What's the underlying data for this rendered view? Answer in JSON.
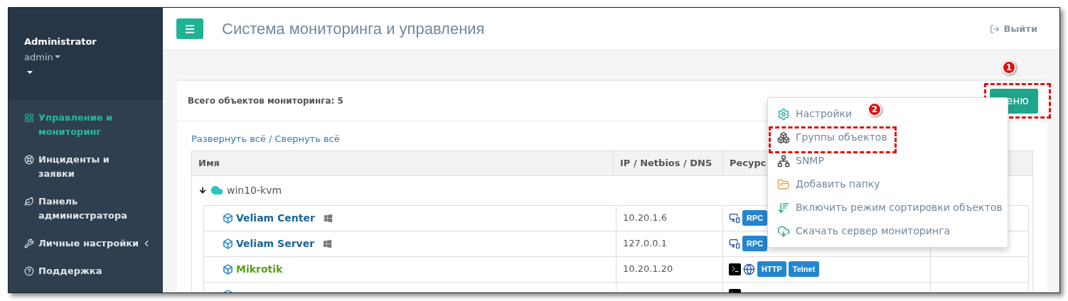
{
  "sidebar": {
    "user_name": "Administrator",
    "user_login": "admin",
    "items": [
      {
        "label": "Управление и мониторинг",
        "selected": true,
        "submenu": false
      },
      {
        "label": "Инциденты и заявки",
        "selected": false,
        "submenu": false
      },
      {
        "label": "Панель администратора",
        "selected": false,
        "submenu": false
      },
      {
        "label": "Личные настройки",
        "selected": false,
        "submenu": true
      },
      {
        "label": "Поддержка",
        "selected": false,
        "submenu": false
      }
    ]
  },
  "header": {
    "title": "Система мониторинга и управления",
    "logout": "Выйти"
  },
  "panel": {
    "summary": "Всего объектов мониторинга: 5",
    "menu_button": "еню",
    "menu_annotation": "1",
    "expand_all": "Развернуть всё",
    "separator": "/",
    "collapse_all": "Свернуть всё"
  },
  "table": {
    "columns": [
      "Имя",
      "IP / Netbios / DNS",
      "Ресурс"
    ],
    "groups": [
      {
        "name": "win10-kvm",
        "expanded": true,
        "children": [
          {
            "kind": "host",
            "name": "Veliam Center",
            "color": "#1a6496",
            "windows": true,
            "ip": "10.20.1.6",
            "resources": [
              {
                "kind": "rdp"
              },
              {
                "kind": "badge",
                "label": "RPC"
              }
            ]
          },
          {
            "kind": "host",
            "name": "Veliam Server",
            "color": "#1a6496",
            "windows": true,
            "ip": "127.0.0.1",
            "resources": [
              {
                "kind": "rdp"
              },
              {
                "kind": "badge",
                "label": "RPC"
              }
            ]
          },
          {
            "kind": "host",
            "name": "Mikrotik",
            "color": "#5a9e1a",
            "windows": false,
            "ip": "10.20.1.20",
            "resources": [
              {
                "kind": "ssh"
              },
              {
                "kind": "globe"
              },
              {
                "kind": "badge",
                "label": "HTTP"
              },
              {
                "kind": "badge",
                "label": "Telnet"
              }
            ]
          },
          {
            "kind": "cut-off",
            "resources": [
              {
                "kind": "ssh"
              }
            ]
          }
        ]
      }
    ]
  },
  "menu": {
    "annotation": "2",
    "items": [
      {
        "label": "Настройки",
        "highlighted": false
      },
      {
        "label": "Группы объектов",
        "highlighted": true
      },
      {
        "label": "SNMP",
        "highlighted": false
      },
      {
        "label": "Добавить папку",
        "highlighted": false
      },
      {
        "label": "Включить режим сортировки объектов",
        "highlighted": false
      },
      {
        "label": "Скачать сервер мониторинга",
        "highlighted": false
      }
    ]
  }
}
